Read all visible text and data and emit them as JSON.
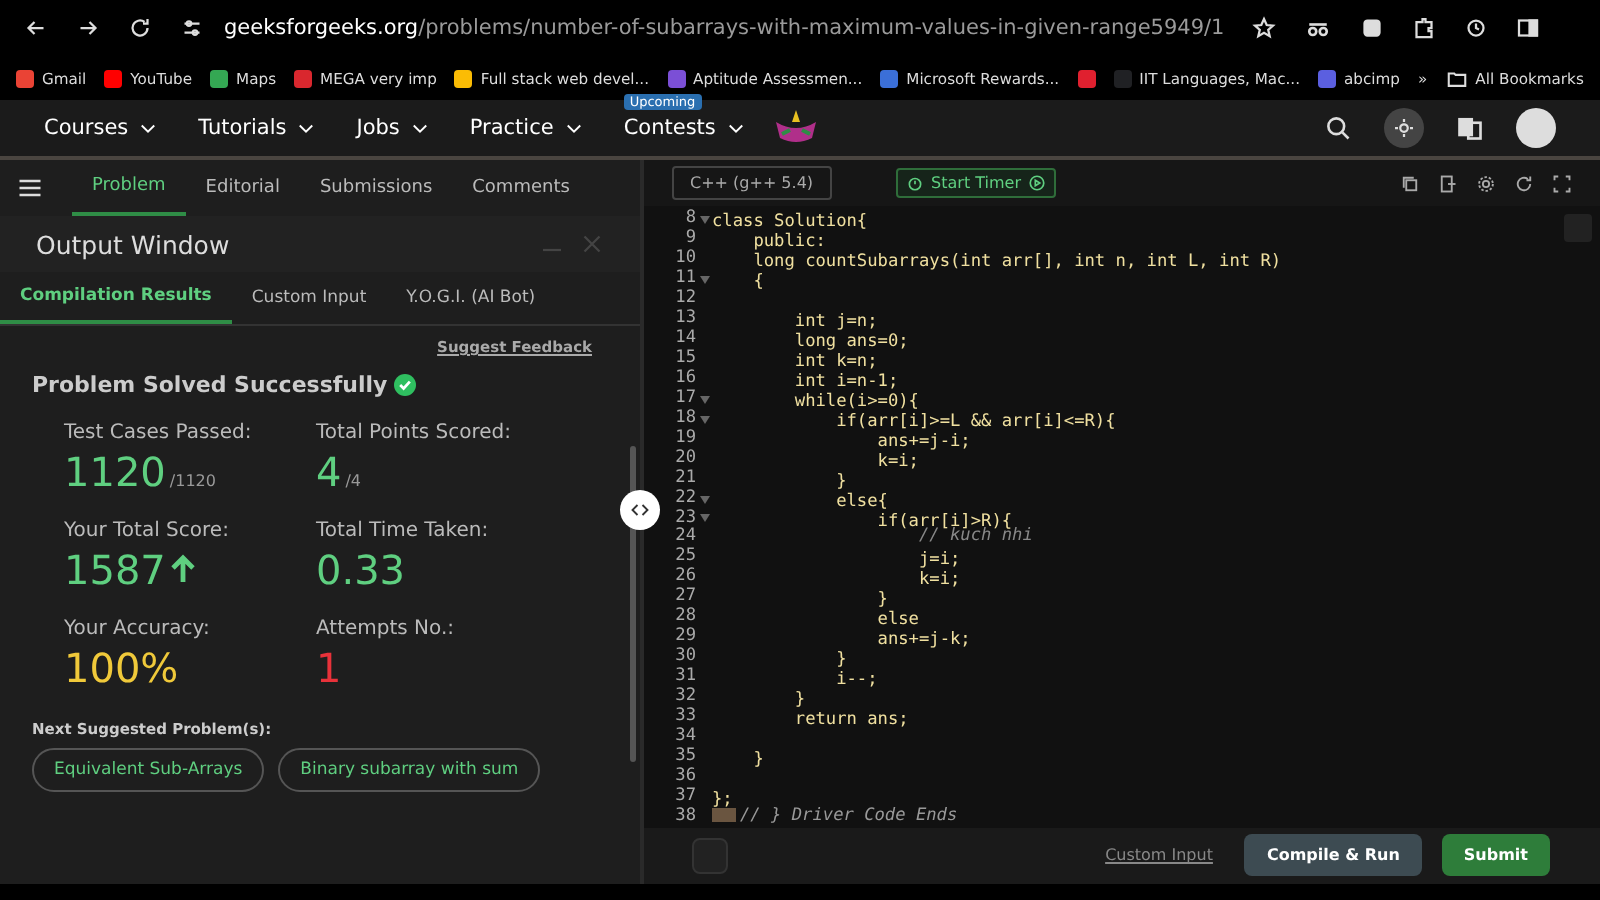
{
  "browser": {
    "url_domain": "geeksforgeeks.org",
    "url_path": "/problems/number-of-subarrays-with-maximum-values-in-given-range5949/1",
    "bookmarks": [
      {
        "label": "Gmail",
        "color": "#ea4335"
      },
      {
        "label": "YouTube",
        "color": "#ff0000"
      },
      {
        "label": "Maps",
        "color": "#34a853"
      },
      {
        "label": "MEGA very imp",
        "color": "#d9272e"
      },
      {
        "label": "Full stack web devel...",
        "color": "#fbbc04"
      },
      {
        "label": "Aptitude Assessmen...",
        "color": "#7b4fd6"
      },
      {
        "label": "Microsoft Rewards...",
        "color": "#3b6fd8"
      },
      {
        "color": "#e0202f"
      },
      {
        "label": "IIT Languages, Mac...",
        "color": "#202124"
      },
      {
        "label": "abcimp",
        "color": "#5b5fe0"
      }
    ],
    "more": "»",
    "all_bookmarks": "All Bookmarks"
  },
  "nav": {
    "items": [
      {
        "label": "Courses"
      },
      {
        "label": "Tutorials"
      },
      {
        "label": "Jobs"
      },
      {
        "label": "Practice"
      },
      {
        "label": "Contests",
        "badge": "Upcoming"
      }
    ]
  },
  "tabs": [
    {
      "label": "Problem",
      "selected": true
    },
    {
      "label": "Editorial",
      "selected": false
    },
    {
      "label": "Submissions",
      "selected": false
    },
    {
      "label": "Comments",
      "selected": false
    }
  ],
  "output": {
    "title": "Output Window",
    "subtabs": [
      {
        "label": "Compilation Results",
        "selected": true
      },
      {
        "label": "Custom Input",
        "selected": false
      },
      {
        "label": "Y.O.G.I. (AI Bot)",
        "selected": false
      }
    ],
    "feedback": "Suggest Feedback",
    "status": "Problem Solved Successfully",
    "stats": [
      {
        "label": "Test Cases Passed:",
        "value": "1120",
        "suffix": "/1120",
        "color": "#5fcf80",
        "arrow": false
      },
      {
        "label": "Total Points Scored:",
        "value": "4",
        "suffix": "/4",
        "color": "#5fcf80",
        "arrow": false
      },
      {
        "label": "Your Total Score:",
        "value": "1587",
        "color": "#5fcf80",
        "arrow": true
      },
      {
        "label": "Total Time Taken:",
        "value": "0.33",
        "color": "#5fcf80",
        "arrow": false
      },
      {
        "label": "Your Accuracy:",
        "value": "100%",
        "color": "#f0c93a",
        "arrow": false
      },
      {
        "label": "Attempts No.:",
        "value": "1",
        "color": "#e8323a",
        "arrow": false
      }
    ],
    "next_title": "Next Suggested Problem(s):",
    "suggestions": [
      "Equivalent Sub-Arrays",
      "Binary subarray with sum"
    ]
  },
  "editor": {
    "language": "C++ (g++ 5.4)",
    "timer": "Start Timer",
    "lines": [
      {
        "number": "8",
        "fold": true,
        "kind": "code",
        "text": "class Solution{"
      },
      {
        "number": "9",
        "fold": false,
        "kind": "code",
        "text": "    public:"
      },
      {
        "number": "10",
        "fold": false,
        "kind": "code",
        "text": "    long countSubarrays(int arr[], int n, int L, int R)"
      },
      {
        "number": "11",
        "fold": true,
        "kind": "code",
        "text": "    {"
      },
      {
        "number": "12",
        "fold": false,
        "kind": "code"
      },
      {
        "number": "13",
        "fold": false,
        "kind": "code",
        "text": "        int j=n;"
      },
      {
        "number": "14",
        "fold": false,
        "kind": "code",
        "text": "        long ans=0;"
      },
      {
        "number": "15",
        "fold": false,
        "kind": "code",
        "text": "        int k=n;"
      },
      {
        "number": "16",
        "fold": false,
        "kind": "code",
        "text": "        int i=n-1;"
      },
      {
        "number": "17",
        "fold": true,
        "kind": "code",
        "text": "        while(i>=0){"
      },
      {
        "number": "18",
        "fold": true,
        "kind": "code",
        "text": "            if(arr[i]>=L && arr[i]<=R){"
      },
      {
        "number": "19",
        "fold": false,
        "kind": "code",
        "text": "                ans+=j-i;"
      },
      {
        "number": "20",
        "fold": false,
        "kind": "code",
        "text": "                k=i;"
      },
      {
        "number": "21",
        "fold": false,
        "kind": "code",
        "text": "            }"
      },
      {
        "number": "22",
        "fold": true,
        "kind": "code",
        "text": "            else{"
      },
      {
        "number": "23",
        "fold": true,
        "kind": "code",
        "text": "                if(arr[i]>R){"
      },
      {
        "number": "24",
        "fold": false,
        "kind": "comment",
        "text": "                    // kuch nhi"
      },
      {
        "number": "25",
        "fold": false,
        "kind": "code",
        "text": "                    j=i;"
      },
      {
        "number": "26",
        "fold": false,
        "kind": "code",
        "text": "                    k=i;"
      },
      {
        "number": "27",
        "fold": false,
        "kind": "code",
        "text": "                }"
      },
      {
        "number": "28",
        "fold": false,
        "kind": "code",
        "text": "                else"
      },
      {
        "number": "29",
        "fold": false,
        "kind": "code",
        "text": "                ans+=j-k;"
      },
      {
        "number": "30",
        "fold": false,
        "kind": "code",
        "text": "            }"
      },
      {
        "number": "31",
        "fold": false,
        "kind": "code",
        "text": "            i--;"
      },
      {
        "number": "32",
        "fold": false,
        "kind": "code",
        "text": "        }"
      },
      {
        "number": "33",
        "fold": false,
        "kind": "code",
        "text": "        return ans;"
      },
      {
        "number": "34",
        "fold": false,
        "kind": "code"
      },
      {
        "number": "35",
        "fold": false,
        "kind": "code",
        "text": "    }"
      },
      {
        "number": "36",
        "fold": false,
        "kind": "code"
      },
      {
        "number": "37",
        "fold": false,
        "kind": "code",
        "text": "};"
      },
      {
        "number": "38",
        "fold": false,
        "kind": "folded-comment",
        "text": "// } Driver Code Ends"
      }
    ],
    "custom_input": "Custom Input",
    "compile": "Compile & Run",
    "submit": "Submit"
  }
}
